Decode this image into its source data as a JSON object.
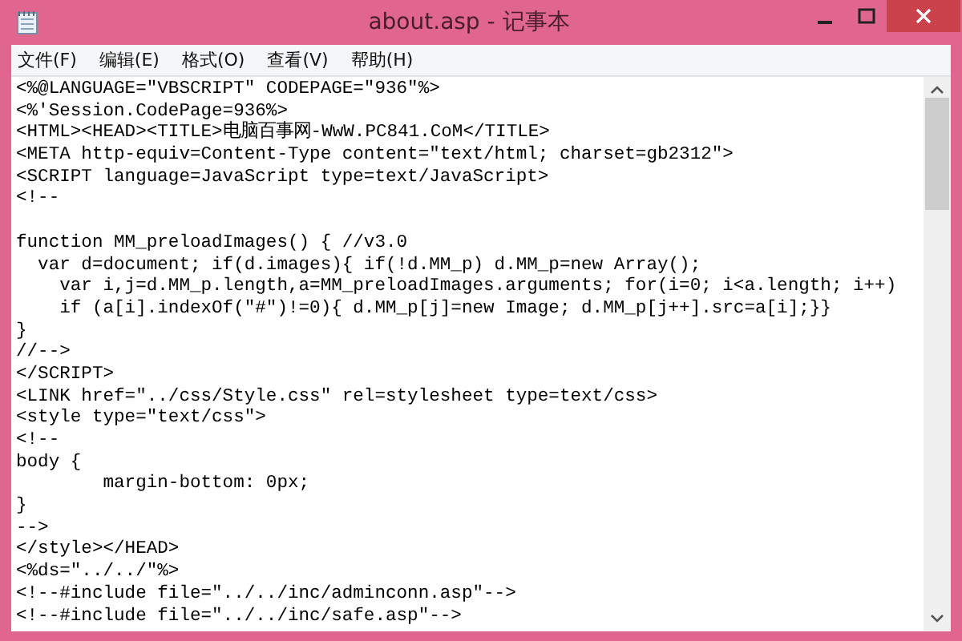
{
  "window": {
    "title": "about.asp - 记事本"
  },
  "menu": [
    {
      "label": "文件(F)"
    },
    {
      "label": "编辑(E)"
    },
    {
      "label": "格式(O)"
    },
    {
      "label": "查看(V)"
    },
    {
      "label": "帮助(H)"
    }
  ],
  "editor": {
    "lines": [
      {
        "kind": "code",
        "text": "<%@LANGUAGE=\"VBSCRIPT\" CODEPAGE=\"936\"%>"
      },
      {
        "kind": "code",
        "text": "<%'Session.CodePage=936%>"
      },
      {
        "kind": "code",
        "text": "<HTML><HEAD><TITLE>电脑百事网-WwW.PC841.CoM</TITLE>"
      },
      {
        "kind": "code",
        "text": "<META http-equiv=Content-Type content=\"text/html; charset=gb2312\">"
      },
      {
        "kind": "code",
        "text": "<SCRIPT language=JavaScript type=text/JavaScript>"
      },
      {
        "kind": "code",
        "text": "<!--"
      },
      {
        "kind": "blank"
      },
      {
        "kind": "code",
        "text": "function MM_preloadImages() { //v3.0"
      },
      {
        "kind": "code",
        "text": "  var d=document; if(d.images){ if(!d.MM_p) d.MM_p=new Array();"
      },
      {
        "kind": "code",
        "text": "    var i,j=d.MM_p.length,a=MM_preloadImages.arguments; for(i=0; i<a.length; i++)"
      },
      {
        "kind": "code",
        "text": "    if (a[i].indexOf(\"#\")!=0){ d.MM_p[j]=new Image; d.MM_p[j++].src=a[i];}}"
      },
      {
        "kind": "code",
        "text": "}"
      },
      {
        "kind": "code",
        "text": "//-->"
      },
      {
        "kind": "code",
        "text": "</SCRIPT>"
      },
      {
        "kind": "code",
        "text": "<LINK href=\"../css/Style.css\" rel=stylesheet type=text/css>"
      },
      {
        "kind": "code",
        "text": "<style type=\"text/css\">"
      },
      {
        "kind": "code",
        "text": "<!--"
      },
      {
        "kind": "code",
        "text": "body {"
      },
      {
        "kind": "code",
        "text": "        margin-bottom: 0px;"
      },
      {
        "kind": "code",
        "text": "}"
      },
      {
        "kind": "code",
        "text": "-->"
      },
      {
        "kind": "code",
        "text": "</style></HEAD>"
      },
      {
        "kind": "code",
        "text": "<%ds=\"../../\"%>"
      },
      {
        "kind": "code",
        "text": "<!--#include file=\"../../inc/adminconn.asp\"-->"
      },
      {
        "kind": "code",
        "text": "<!--#include file=\"../../inc/safe.asp\"-->"
      }
    ]
  }
}
